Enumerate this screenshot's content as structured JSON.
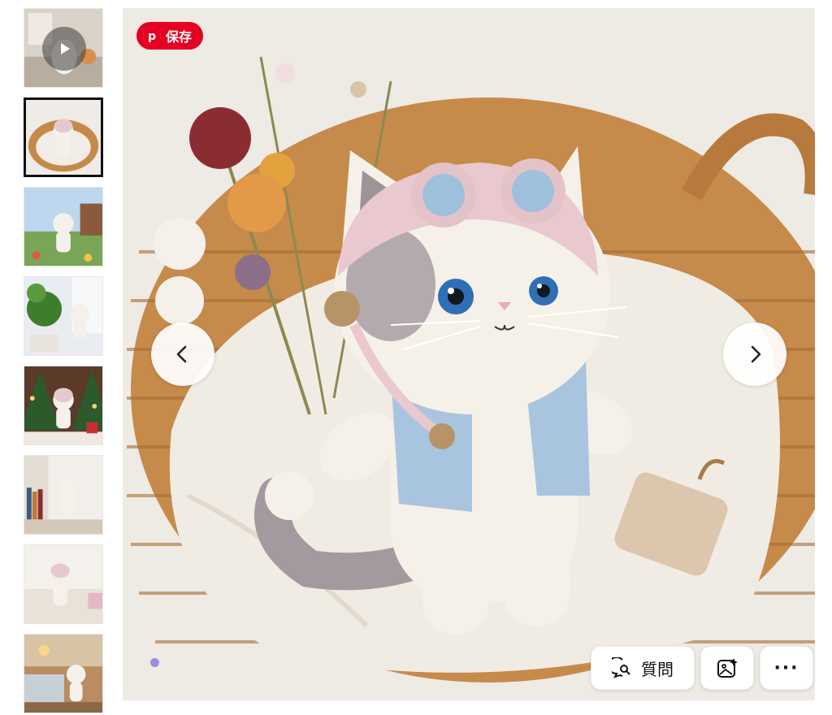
{
  "save_button": {
    "label": "保存",
    "icon": "pinterest-icon",
    "color": "#e60023"
  },
  "thumbnails": [
    {
      "name": "kitchen-video",
      "is_video": true,
      "selected": false
    },
    {
      "name": "basket",
      "is_video": false,
      "selected": true
    },
    {
      "name": "garden",
      "is_video": false,
      "selected": false
    },
    {
      "name": "houseplant-window",
      "is_video": false,
      "selected": false
    },
    {
      "name": "christmas-tree",
      "is_video": false,
      "selected": false
    },
    {
      "name": "bookshelf",
      "is_video": false,
      "selected": false
    },
    {
      "name": "rug",
      "is_video": false,
      "selected": false
    },
    {
      "name": "living-room",
      "is_video": false,
      "selected": false
    }
  ],
  "navigation": {
    "prev_icon": "chevron-left-icon",
    "next_icon": "chevron-right-icon"
  },
  "toolbar": {
    "ask_label": "質問",
    "ask_icon": "chat-bubble-search-icon",
    "lens_icon": "visual-search-icon",
    "more_label": "···"
  },
  "colors": {
    "accent": "#e60023",
    "indicator_dot": "#9b8cdc"
  }
}
